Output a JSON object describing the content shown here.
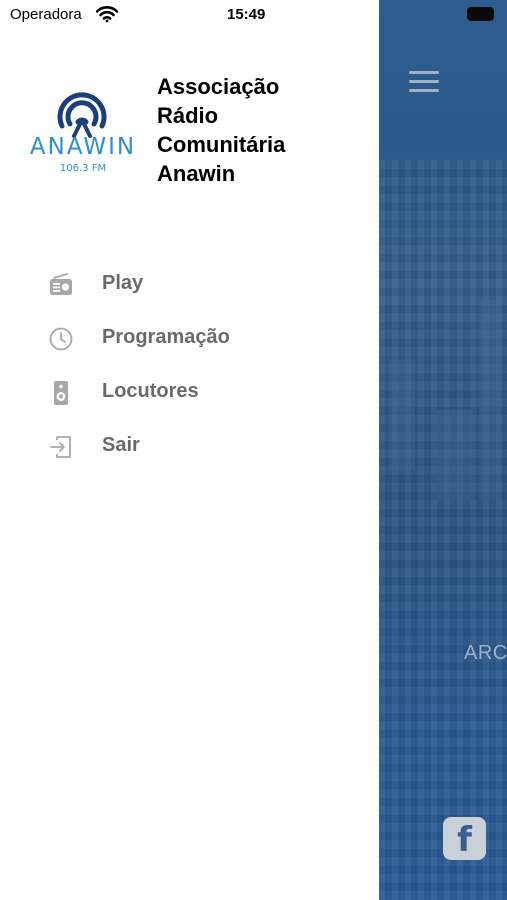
{
  "status_bar": {
    "carrier": "Operadora",
    "time": "15:49"
  },
  "header": {
    "logo": {
      "name": "ANAWIN",
      "frequency": "106.3 FM"
    },
    "station_name_lines": [
      "Associação",
      "Rádio",
      "Comunitária",
      "Anawin"
    ]
  },
  "menu": {
    "items": [
      {
        "label": "Play",
        "icon": "radio-icon"
      },
      {
        "label": "Programação",
        "icon": "clock-icon"
      },
      {
        "label": "Locutores",
        "icon": "speaker-icon"
      },
      {
        "label": "Sair",
        "icon": "logout-icon"
      }
    ]
  },
  "background_app": {
    "visible_text": "ARC"
  },
  "colors": {
    "brand_blue": "#2f8fcf",
    "brand_dark_blue": "#1a3f7a",
    "menu_text": "#6a6a6a",
    "icon_gray": "#a8a8a8",
    "background_blue": "#2d5a8c"
  }
}
